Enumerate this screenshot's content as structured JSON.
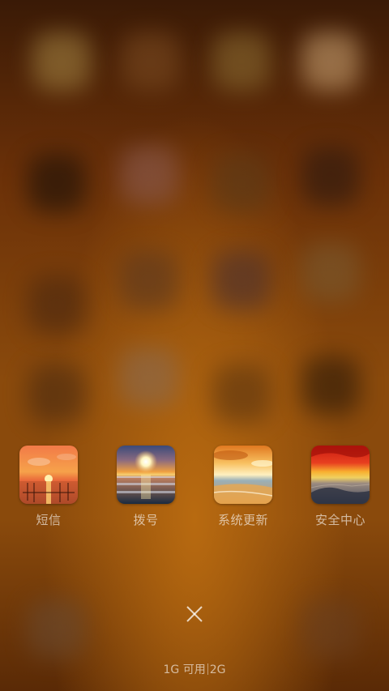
{
  "recent_apps": [
    {
      "label": "短信",
      "icon": "sunset-lake-thumbnail"
    },
    {
      "label": "拨号",
      "icon": "ocean-sunrise-thumbnail"
    },
    {
      "label": "系统更新",
      "icon": "beach-sunset-thumbnail"
    },
    {
      "label": "安全中心",
      "icon": "red-sky-sunset-thumbnail"
    }
  ],
  "close_icon": "close-icon",
  "memory": {
    "available": "1G 可用",
    "total": "2G"
  },
  "colors": {
    "label_text": "#ffffffa0",
    "background_accent": "#a05a0c"
  }
}
